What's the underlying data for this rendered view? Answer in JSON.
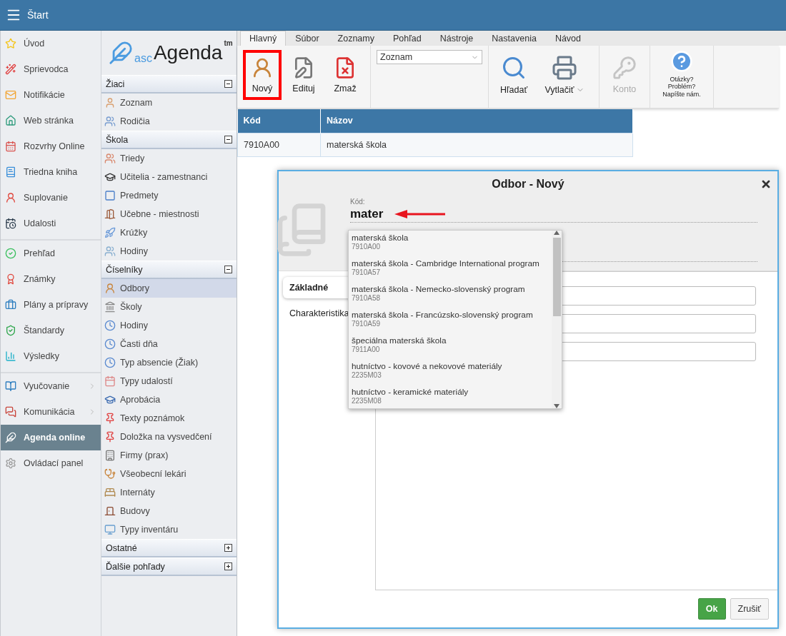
{
  "topbar": {
    "title": "Štart"
  },
  "nav": [
    [
      {
        "label": "Úvod",
        "selected": false,
        "submenu": false
      },
      {
        "label": "Sprievodca",
        "selected": false,
        "submenu": false
      },
      {
        "label": "Notifikácie",
        "selected": false,
        "submenu": false
      },
      {
        "label": "Web stránka",
        "selected": false,
        "submenu": false
      },
      {
        "label": "Rozvrhy Online",
        "selected": false,
        "submenu": false
      },
      {
        "label": "Triedna kniha",
        "selected": false,
        "submenu": false
      },
      {
        "label": "Suplovanie",
        "selected": false,
        "submenu": false
      },
      {
        "label": "Udalosti",
        "selected": false,
        "submenu": false
      }
    ],
    [
      {
        "label": "Prehľad",
        "selected": false,
        "submenu": false
      },
      {
        "label": "Známky",
        "selected": false,
        "submenu": false
      },
      {
        "label": "Plány a prípravy",
        "selected": false,
        "submenu": false
      },
      {
        "label": "Štandardy",
        "selected": false,
        "submenu": false
      },
      {
        "label": "Výsledky",
        "selected": false,
        "submenu": false
      }
    ],
    [
      {
        "label": "Vyučovanie",
        "selected": false,
        "submenu": true
      },
      {
        "label": "Komunikácia",
        "selected": false,
        "submenu": true
      },
      {
        "label": "Agenda online",
        "selected": true,
        "submenu": false
      },
      {
        "label": "Ovládací panel",
        "selected": false,
        "submenu": false
      }
    ]
  ],
  "logo": {
    "prefix": "asc",
    "name": "Agenda",
    "mark": "tm"
  },
  "sections": [
    {
      "title": "Žiaci",
      "expanded": true,
      "items": [
        {
          "label": "Zoznam",
          "selected": false
        },
        {
          "label": "Rodičia",
          "selected": false
        }
      ]
    },
    {
      "title": "Škola",
      "expanded": true,
      "items": [
        {
          "label": "Triedy",
          "selected": false
        },
        {
          "label": "Učitelia - zamestnanci",
          "selected": false
        },
        {
          "label": "Predmety",
          "selected": false
        },
        {
          "label": "Učebne - miestnosti",
          "selected": false
        },
        {
          "label": "Krúžky",
          "selected": false
        },
        {
          "label": "Hodiny",
          "selected": false
        }
      ]
    },
    {
      "title": "Číselníky",
      "expanded": true,
      "items": [
        {
          "label": "Odbory",
          "selected": true
        },
        {
          "label": "Školy",
          "selected": false
        },
        {
          "label": "Hodiny",
          "selected": false
        },
        {
          "label": "Časti dňa",
          "selected": false
        },
        {
          "label": "Typ absencie (Žiak)",
          "selected": false
        },
        {
          "label": "Typy udalostí",
          "selected": false
        },
        {
          "label": "Aprobácia",
          "selected": false
        },
        {
          "label": "Texty poznámok",
          "selected": false
        },
        {
          "label": "Doložka na vysvedčení",
          "selected": false
        },
        {
          "label": "Firmy (prax)",
          "selected": false
        },
        {
          "label": "Všeobecní lekári",
          "selected": false
        },
        {
          "label": "Internáty",
          "selected": false
        },
        {
          "label": "Budovy",
          "selected": false
        },
        {
          "label": "Typy inventáru",
          "selected": false
        }
      ]
    },
    {
      "title": "Ostatné",
      "expanded": false
    },
    {
      "title": "Ďalšie pohľady",
      "expanded": false
    }
  ],
  "ribbon_tabs": [
    {
      "label": "Hlavný",
      "selected": true
    },
    {
      "label": "Súbor",
      "selected": false
    },
    {
      "label": "Zoznamy",
      "selected": false
    },
    {
      "label": "Pohľad",
      "selected": false
    },
    {
      "label": "Nástroje",
      "selected": false
    },
    {
      "label": "Nastavenia",
      "selected": false
    },
    {
      "label": "Návod",
      "selected": false
    }
  ],
  "toolbar": [
    [
      {
        "kind": "button",
        "label": "Nový",
        "highlighted": true,
        "disabled": false,
        "dropdown": false
      },
      {
        "kind": "button",
        "label": "Edituj",
        "highlighted": false,
        "disabled": false,
        "dropdown": false
      },
      {
        "kind": "button",
        "label": "Zmaž",
        "highlighted": false,
        "disabled": false,
        "dropdown": false
      }
    ],
    [
      {
        "kind": "select",
        "value": "Zoznam"
      }
    ],
    [
      {
        "kind": "button",
        "label": "Hľadať",
        "highlighted": false,
        "disabled": false,
        "dropdown": false
      },
      {
        "kind": "button",
        "label": "Vytlačiť",
        "highlighted": false,
        "disabled": false,
        "dropdown": true
      }
    ],
    [
      {
        "kind": "button",
        "label": "Konto",
        "highlighted": false,
        "disabled": true,
        "dropdown": false
      }
    ],
    [
      {
        "kind": "help",
        "label": "Otázky? Problém? Napíšte nám."
      }
    ]
  ],
  "table": {
    "columns": [
      "Kód",
      "Názov"
    ],
    "rows": [
      [
        "7910A00",
        "materská škola"
      ]
    ]
  },
  "dialog": {
    "title": "Odbor - Nový",
    "field": {
      "label": "Kód:",
      "value": "mater"
    },
    "suggestions": [
      {
        "name": "materská škola",
        "code": "7910A00"
      },
      {
        "name": "materská škola - Cambridge International program",
        "code": "7910A57"
      },
      {
        "name": "materská škola - Nemecko-slovenský program",
        "code": "7910A58"
      },
      {
        "name": "materská škola - Francúzsko-slovenský program",
        "code": "7910A59"
      },
      {
        "name": "špeciálna materská škola",
        "code": "7911A00"
      },
      {
        "name": "hutníctvo - kovové a nekovové materiály",
        "code": "2235M03"
      },
      {
        "name": "hutníctvo - keramické materiály",
        "code": "2235M08"
      }
    ],
    "tabs": [
      {
        "label": "Základné",
        "selected": true
      },
      {
        "label": "Charakteristika",
        "selected": false
      }
    ],
    "buttons": [
      {
        "kind": "primary",
        "label": "Ok"
      },
      {
        "kind": "secondary",
        "label": "Zrušiť"
      }
    ]
  }
}
